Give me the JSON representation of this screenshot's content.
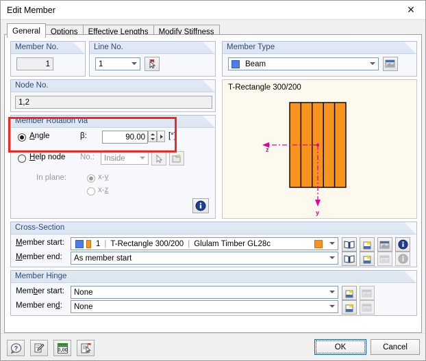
{
  "window": {
    "title": "Edit Member",
    "close_icon": "close-icon"
  },
  "tabs": [
    {
      "label": "General",
      "active": true
    },
    {
      "label": "Options",
      "active": false
    },
    {
      "label": "Effective Lengths",
      "active": false
    },
    {
      "label": "Modify Stiffness",
      "active": false
    }
  ],
  "member_no": {
    "title": "Member No.",
    "value": "1"
  },
  "line_no": {
    "title": "Line No.",
    "value": "1",
    "pick_icon": "pick-line-icon"
  },
  "member_type": {
    "title": "Member Type",
    "value": "Beam",
    "swatch_color": "#4d7ee8",
    "edit_icon": "edit-properties-icon"
  },
  "node_no": {
    "title": "Node No.",
    "value": "1,2"
  },
  "rotation": {
    "title": "Member Rotation via",
    "angle_label": "Angle",
    "beta_label": "β:",
    "beta_value": "90.00",
    "unit": "[°]",
    "angle_selected": true,
    "help_node_label": "Help node",
    "help_node_no_label": "No.:",
    "help_node_value": "Inside",
    "help_node_selected": false,
    "in_plane_label": "In plane:",
    "plane_xy": "x-y",
    "plane_xz": "x-z",
    "plane_selected": "x-y",
    "pick_icon": "pick-node-icon",
    "new_icon": "new-node-icon",
    "info_icon": "info-icon"
  },
  "preview": {
    "caption": "T-Rectangle 300/200",
    "axis_z_label": "z",
    "axis_y_label": "y",
    "section_color": "#F7941E",
    "axis_color": "#E3009B"
  },
  "cross_section": {
    "title": "Cross-Section",
    "start_label": "Member start:",
    "end_label": "Member end:",
    "start_no": "1",
    "start_section": "T-Rectangle 300/200",
    "start_material": "Glulam Timber GL28c",
    "start_swatch_a": "#4d7ee8",
    "start_swatch_b": "#F7941E",
    "start_swatch_end": "#F7941E",
    "end_value": "As member start",
    "icons": [
      "library-icon",
      "new-section-icon",
      "edit-section-icon",
      "info-icon"
    ]
  },
  "member_hinge": {
    "title": "Member Hinge",
    "start_label": "Member start:",
    "end_label": "Member end:",
    "start_value": "None",
    "end_value": "None",
    "icons": [
      "new-hinge-icon",
      "edit-hinge-icon"
    ]
  },
  "footer": {
    "icons": [
      "help-icon",
      "comment-icon",
      "units-icon",
      "select-icon"
    ],
    "ok_label": "OK",
    "cancel_label": "Cancel"
  },
  "highlight": {
    "color": "#ee2a24"
  }
}
